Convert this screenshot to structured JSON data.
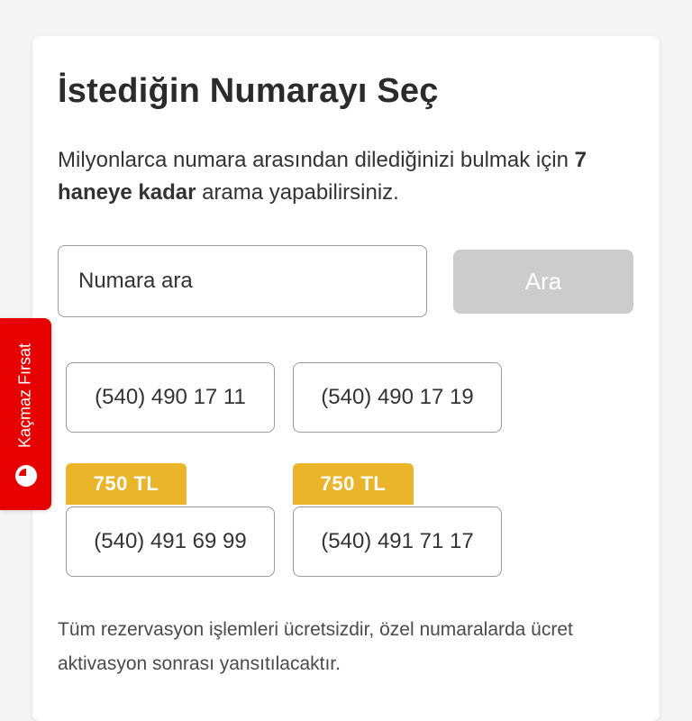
{
  "picker": {
    "title": "İstediğin Numarayı Seç",
    "description_part1": "Milyonlarca numara arasından dilediğinizi bulmak için ",
    "description_bold": "7 haneye kadar",
    "description_part2": " arama yapabilirsiniz."
  },
  "search": {
    "placeholder": "Numara ara",
    "button_label": "Ara"
  },
  "numbers": [
    {
      "number": "(540) 490 17 11",
      "price": ""
    },
    {
      "number": "(540) 490 17 19",
      "price": ""
    },
    {
      "number": "(540) 491 69 99",
      "price": "750 TL"
    },
    {
      "number": "(540) 491 71 17",
      "price": "750 TL"
    }
  ],
  "footer": {
    "note": "Tüm rezervasyon işlemleri ücretsizdir, özel numaralarda ücret aktivasyon sonrası yansıtılacaktır."
  },
  "side_tab": {
    "label": "Kaçmaz Fırsat",
    "icon": "clock-icon"
  },
  "colors": {
    "brand_red": "#e60000",
    "price_tag": "#ebb52b",
    "disabled_button": "#cccccc"
  }
}
